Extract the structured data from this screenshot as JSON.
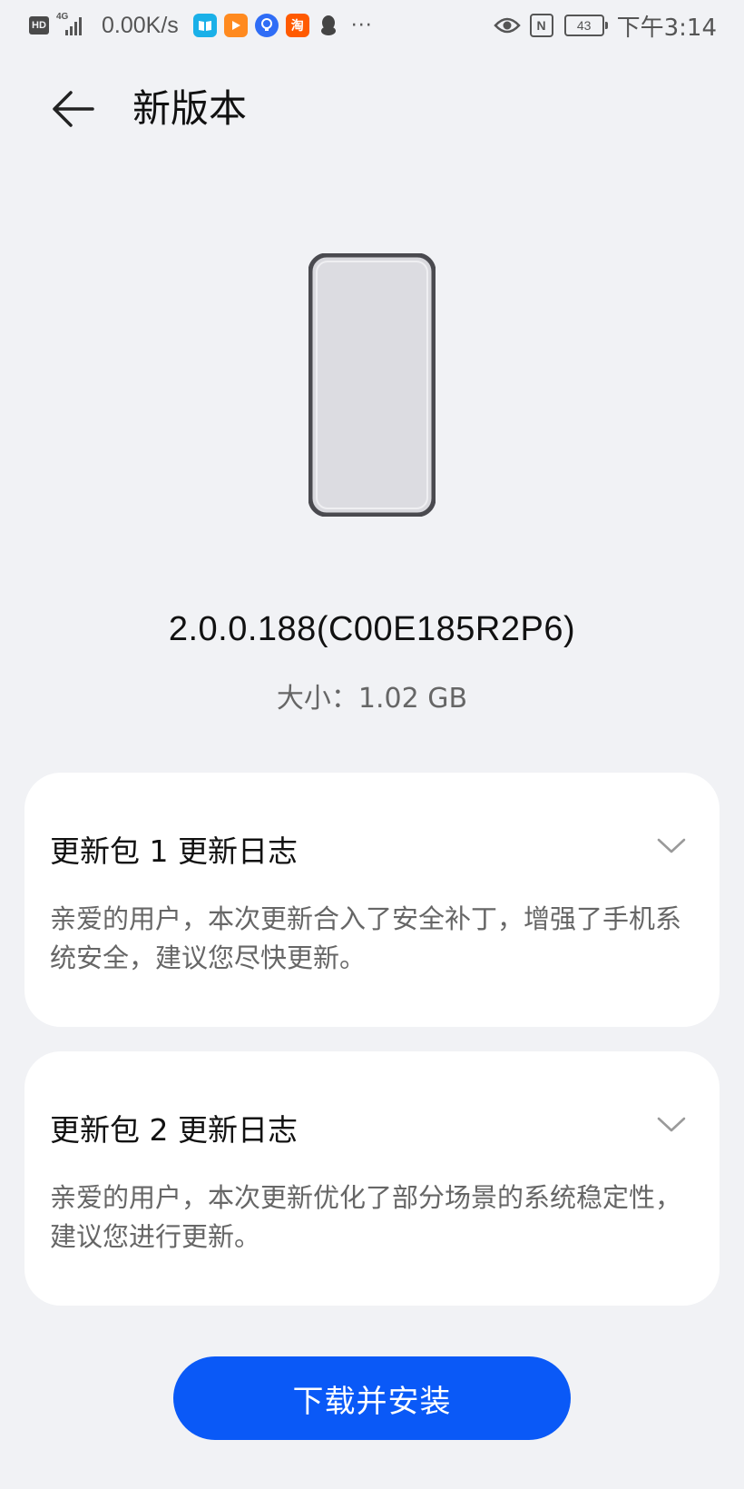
{
  "status_bar": {
    "hd_label": "HD",
    "network_type": "4G",
    "net_speed": "0.00K/s",
    "taobao_glyph": "淘",
    "more_label": "···",
    "nfc_label": "N",
    "battery_level": "43",
    "time": "下午3:14",
    "icons": [
      "hd-icon",
      "signal-icon",
      "reader-app-icon",
      "video-app-icon",
      "bulb-app-icon",
      "taobao-app-icon",
      "qq-icon",
      "more-icon",
      "eye-comfort-icon",
      "nfc-icon",
      "battery-icon"
    ]
  },
  "header": {
    "title": "新版本",
    "back_icon": "arrow-left-icon"
  },
  "version": {
    "number": "2.0.0.188(C00E185R2P6)",
    "size_label": "大小：1.02 GB"
  },
  "changelogs": [
    {
      "title": "更新包 1 更新日志",
      "description": "亲爱的用户，本次更新合入了安全补丁，增强了手机系统安全，建议您尽快更新。"
    },
    {
      "title": "更新包 2 更新日志",
      "description": "亲爱的用户，本次更新优化了部分场景的系统稳定性，建议您进行更新。"
    }
  ],
  "actions": {
    "download_label": "下载并安装"
  },
  "colors": {
    "background": "#f1f2f5",
    "card": "#ffffff",
    "accent": "#0a59f7",
    "text_primary": "#111111",
    "text_secondary": "#666666"
  }
}
